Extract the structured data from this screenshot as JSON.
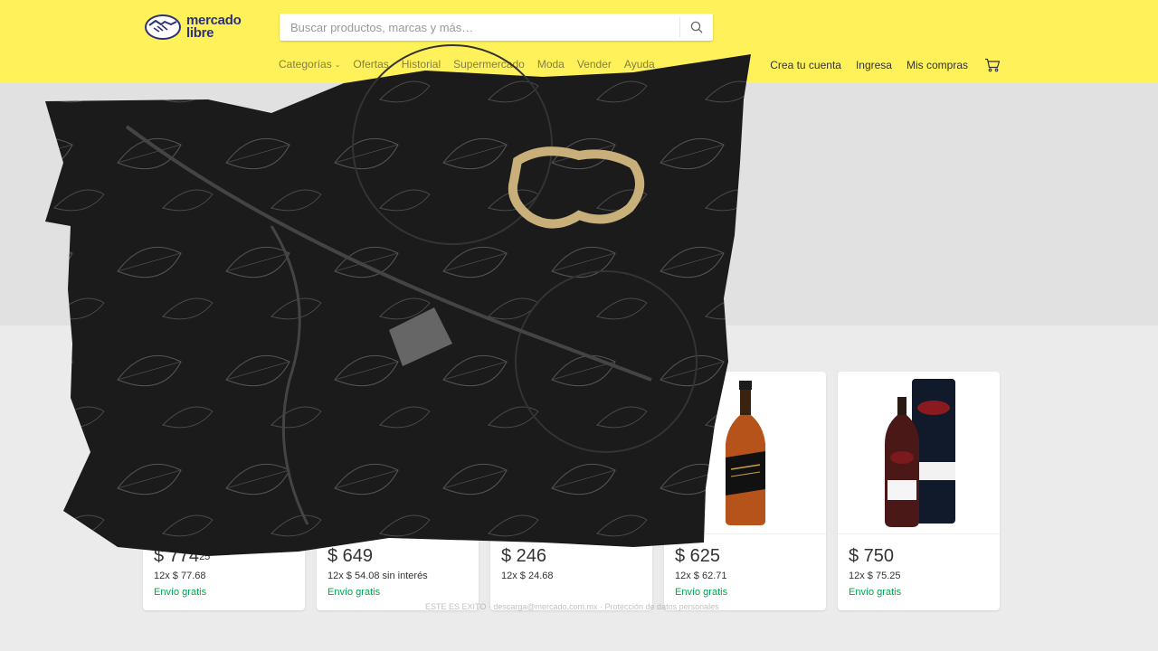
{
  "brand": {
    "line1": "mercado",
    "line2": "libre",
    "color": "#2d3277",
    "header_color": "#fff159"
  },
  "search": {
    "placeholder": "Buscar productos, marcas y más…",
    "value": ""
  },
  "nav": {
    "categories": "Categorías",
    "items": [
      "Ofertas",
      "Historial",
      "Supermercado",
      "Moda",
      "Vender",
      "Ayuda"
    ]
  },
  "account": {
    "create": "Crea tu cuenta",
    "login": "Ingresa",
    "purchases": "Mis compras"
  },
  "products": [
    {
      "price": "$ 774",
      "cents": "25",
      "installments": "12x $ 77.68",
      "shipping": "Envío gratis"
    },
    {
      "price": "$ 649",
      "cents": "",
      "installments": "12x $ 54.08 sin interés",
      "shipping": "Envío gratis"
    },
    {
      "price": "$ 246",
      "cents": "",
      "installments": "12x $ 24.68",
      "shipping": ""
    },
    {
      "price": "$ 625",
      "cents": "",
      "installments": "12x $ 62.71",
      "shipping": "Envío gratis"
    },
    {
      "price": "$ 750",
      "cents": "",
      "installments": "12x $ 75.25",
      "shipping": "Envío gratis"
    }
  ],
  "footer": "ESTE ES EXITO · descarga@mercado.com.mx · Protección de datos personales",
  "colors": {
    "shipping_green": "#00a650",
    "overlay": "#1a1a1a"
  }
}
